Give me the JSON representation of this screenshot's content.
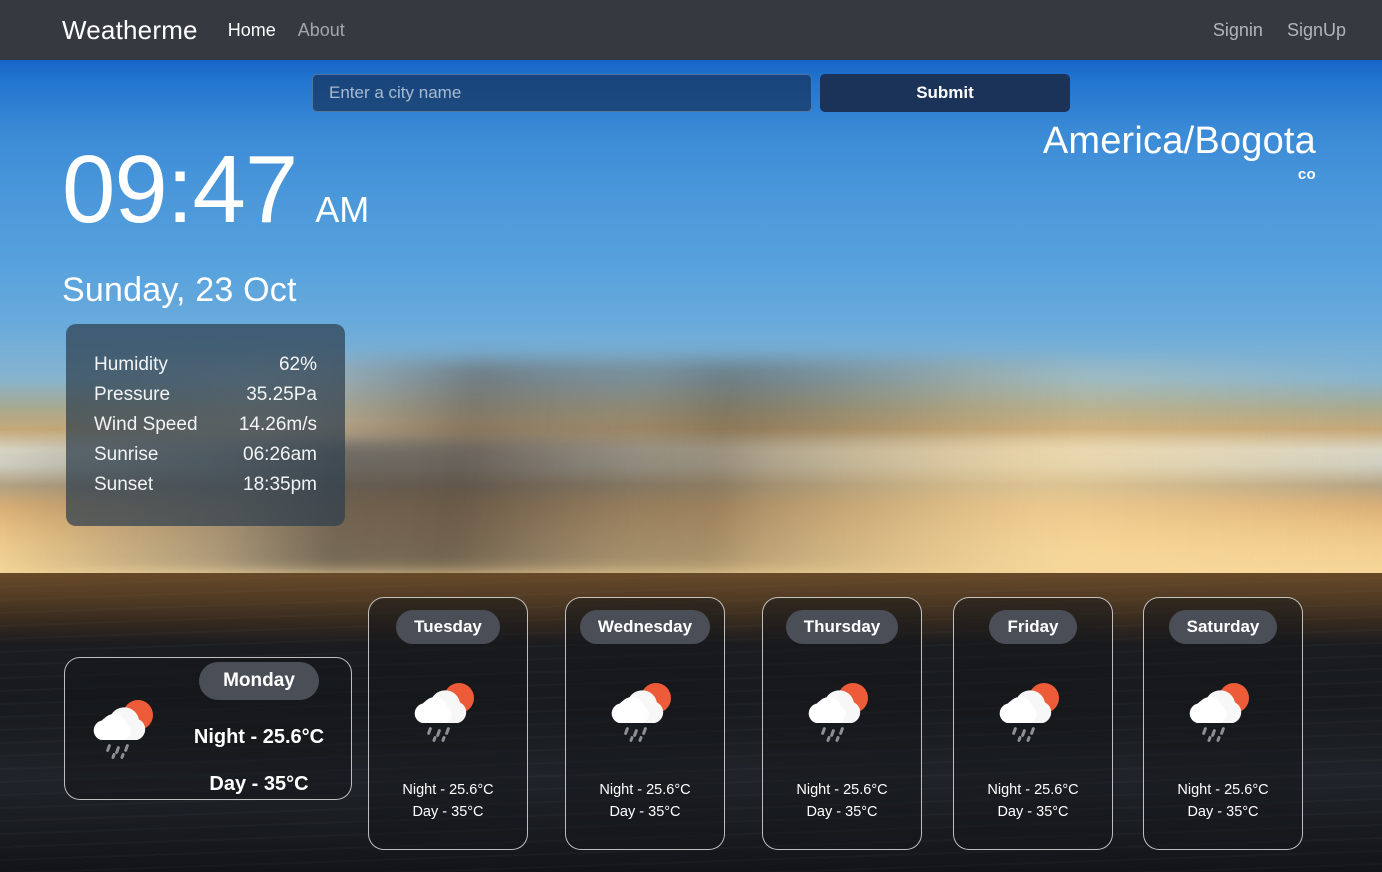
{
  "navbar": {
    "brand": "Weatherme",
    "links": [
      {
        "label": "Home",
        "active": true
      },
      {
        "label": "About",
        "active": false
      }
    ],
    "auth": [
      {
        "label": "Signin"
      },
      {
        "label": "SignUp"
      }
    ]
  },
  "search": {
    "placeholder": "Enter a city name",
    "value": "",
    "submit_label": "Submit"
  },
  "location": {
    "timezone": "America/Bogota",
    "country_code": "co"
  },
  "clock": {
    "time": "09:47",
    "meridiem": "AM",
    "date": "Sunday, 23 Oct"
  },
  "stats": [
    {
      "label": "Humidity",
      "value": "62%"
    },
    {
      "label": "Pressure",
      "value": "35.25Pa"
    },
    {
      "label": "Wind Speed",
      "value": "14.26m/s"
    },
    {
      "label": "Sunrise",
      "value": "06:26am"
    },
    {
      "label": "Sunset",
      "value": "18:35pm"
    }
  ],
  "forecast": {
    "today": {
      "day": "Monday",
      "night_temp": "Night - 25.6°C",
      "day_temp": "Day - 35°C",
      "icon": "rain-cloud-sun-icon"
    },
    "days": [
      {
        "day": "Tuesday",
        "night_temp": "Night - 25.6°C",
        "day_temp": "Day - 35°C",
        "icon": "rain-cloud-sun-icon"
      },
      {
        "day": "Wednesday",
        "night_temp": "Night - 25.6°C",
        "day_temp": "Day - 35°C",
        "icon": "rain-cloud-sun-icon"
      },
      {
        "day": "Thursday",
        "night_temp": "Night - 25.6°C",
        "day_temp": "Day - 35°C",
        "icon": "rain-cloud-sun-icon"
      },
      {
        "day": "Friday",
        "night_temp": "Night - 25.6°C",
        "day_temp": "Day - 35°C",
        "icon": "rain-cloud-sun-icon"
      },
      {
        "day": "Saturday",
        "night_temp": "Night - 25.6°C",
        "day_temp": "Day - 35°C",
        "icon": "rain-cloud-sun-icon"
      }
    ]
  },
  "colors": {
    "navbar_bg": "#343a40",
    "submit_bg": "#1b3358",
    "pill_bg": "#4a4f57",
    "sun_icon": "#ee5b38",
    "cloud_icon": "#f7f7f7",
    "panel_bg": "rgba(46,62,78,0.72)"
  }
}
